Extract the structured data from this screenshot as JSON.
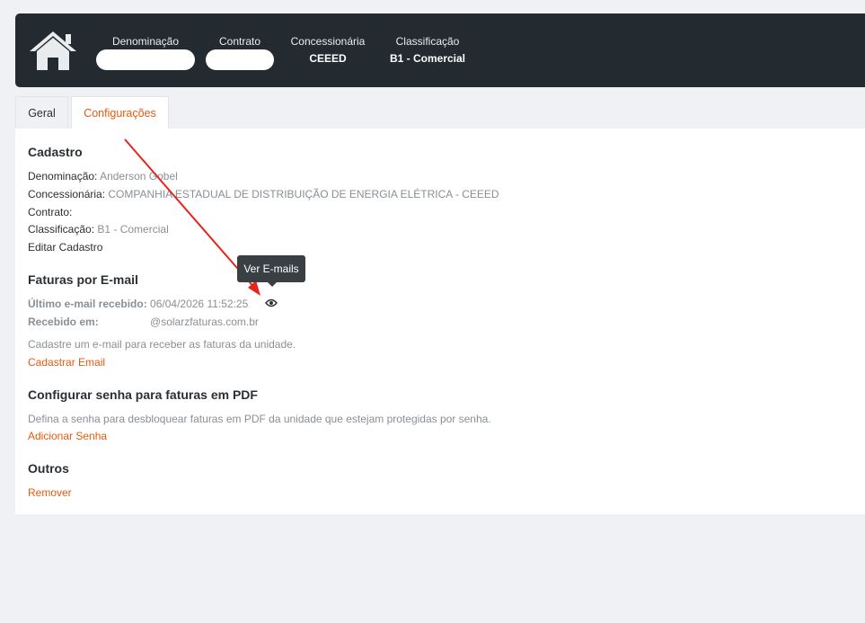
{
  "header": {
    "denominacao_label": "Denominação",
    "contrato_label": "Contrato",
    "concessionaria_label": "Concessionária",
    "concessionaria_value": "CEEED",
    "classificacao_label": "Classificação",
    "classificacao_value": "B1 - Comercial"
  },
  "tabs": [
    {
      "label": "Geral"
    },
    {
      "label": "Configurações",
      "active": true
    }
  ],
  "cadastro": {
    "title": "Cadastro",
    "denominacao_label": "Denominação:",
    "denominacao_value": "Anderson Gobel",
    "concessionaria_label": "Concessionária:",
    "concessionaria_value": "COMPANHIA ESTADUAL DE DISTRIBUIÇÃO DE ENERGIA ELÉTRICA - CEEED",
    "contrato_label": "Contrato:",
    "contrato_value": "",
    "classificacao_label": "Classificação:",
    "classificacao_value": "B1 - Comercial",
    "edit_link": "Editar Cadastro"
  },
  "faturas_email": {
    "title": "Faturas por E-mail",
    "ultimo_label": "Último e-mail recebido:",
    "ultimo_value": "06/04/2026 11:52:25",
    "recebido_label": "Recebido em:",
    "recebido_value": "@solarzfaturas.com.br",
    "description": "Cadastre um e-mail para receber as faturas da unidade.",
    "link": "Cadastrar Email",
    "tooltip": "Ver E-mails",
    "icon": "eye-icon"
  },
  "senha_pdf": {
    "title": "Configurar senha para faturas em PDF",
    "description": "Defina a senha para desbloquear faturas em PDF da unidade que estejam protegidas por senha.",
    "link": "Adicionar Senha"
  },
  "outros": {
    "title": "Outros",
    "link": "Remover"
  },
  "colors": {
    "header_bg": "#242b30",
    "accent": "#e8590c",
    "annotation_arrow": "#e8241c",
    "page_bg": "#f0f1f4"
  }
}
